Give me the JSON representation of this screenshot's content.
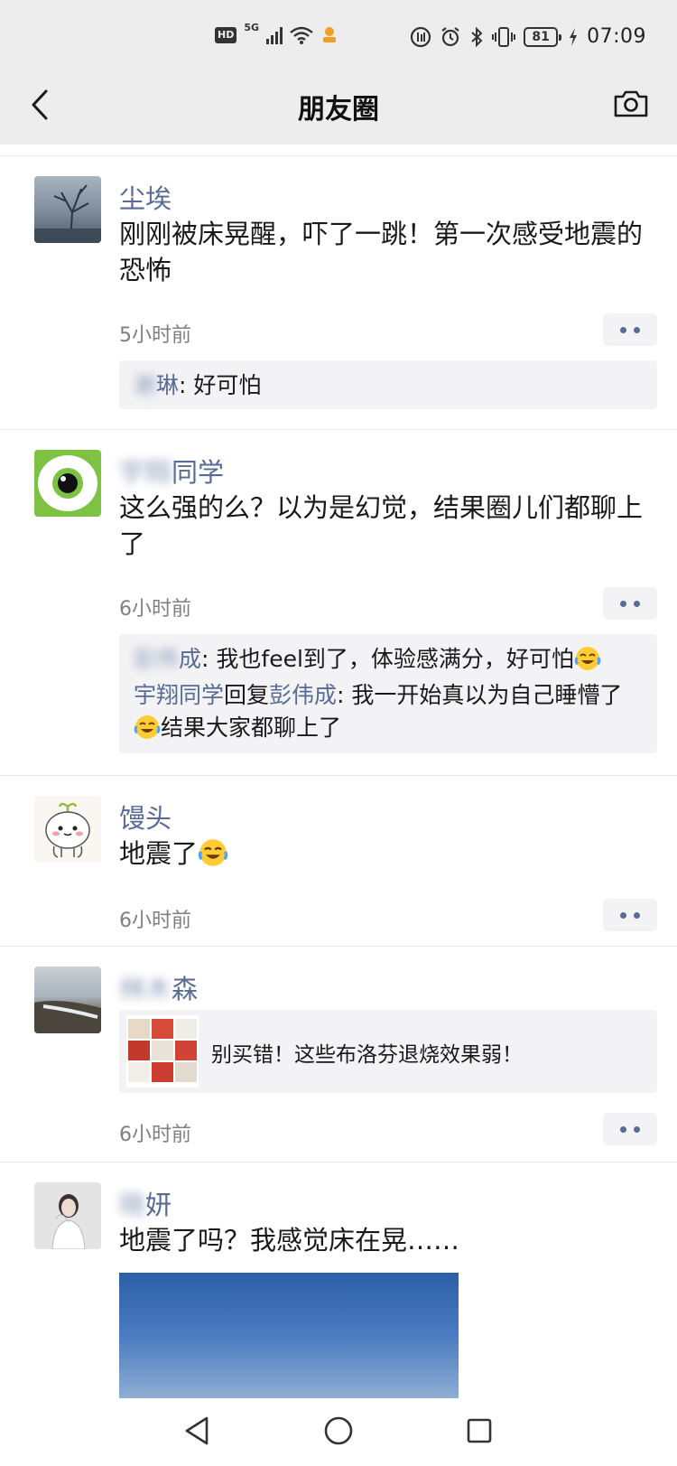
{
  "status_bar": {
    "hd": "HD",
    "network": "5G",
    "battery": "81",
    "time": "07:09"
  },
  "header": {
    "title": "朋友圈",
    "back_icon": "chevron-left-icon",
    "camera_icon": "camera-icon"
  },
  "posts": [
    {
      "nickname": "尘埃",
      "text": "刚刚被床晃醒，吓了一跳！第一次感受地震的恐怖",
      "time": "5小时前",
      "comments": [
        {
          "name_blur": "",
          "name": "琳",
          "sep": ": ",
          "text": "好可怕"
        }
      ]
    },
    {
      "nickname_blur": "",
      "nickname": "同学",
      "text": "这么强的么？以为是幻觉，结果圈儿们都聊上了",
      "time": "6小时前",
      "comments": [
        {
          "name_blur": "",
          "name": "成",
          "sep": ": ",
          "text": "我也feel到了，体验感满分，好可怕"
        },
        {
          "name": "宇翔同学",
          "reply": "回复",
          "to": "彭伟成",
          "sep": ": ",
          "text_a": "我一开始真以为自己睡懵了",
          "text_b": "结果大家都聊上了"
        }
      ]
    },
    {
      "nickname": "馒头",
      "text": "地震了",
      "time": "6小时前"
    },
    {
      "nickname_blur": "",
      "nickname": "森",
      "link_title": "别买错！这些布洛芬退烧效果弱！",
      "time": "6小时前"
    },
    {
      "nickname_blur": "",
      "nickname": "妍",
      "text": "地震了吗？我感觉床在晃……"
    }
  ],
  "colors": {
    "link_blue": "#576b95",
    "header_bg": "#ededed",
    "comment_bg": "#f3f3f5"
  }
}
